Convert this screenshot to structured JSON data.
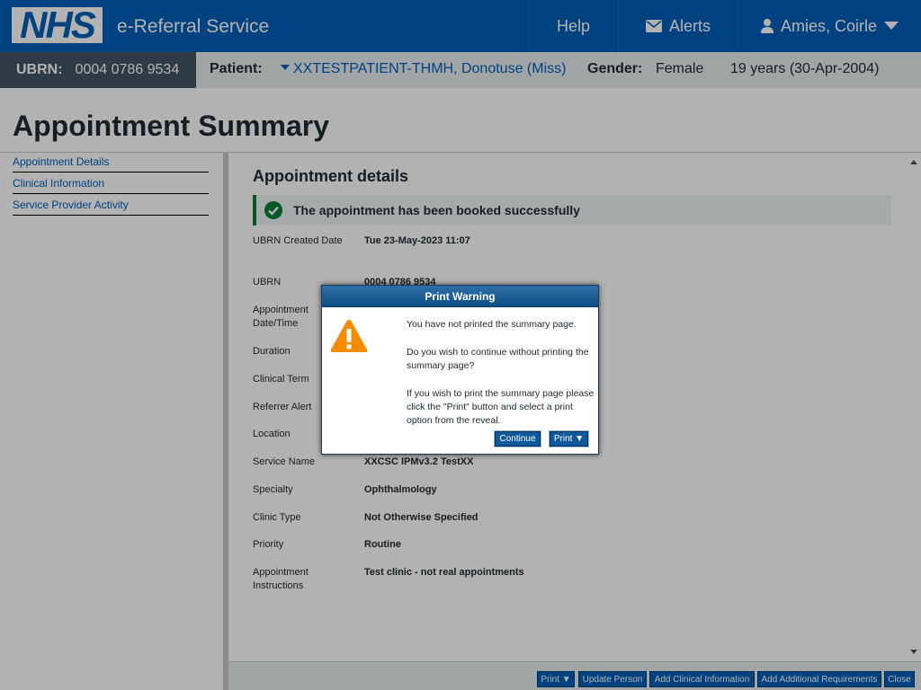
{
  "header": {
    "logo": "NHS",
    "service_name": "e-Referral Service",
    "help": "Help",
    "alerts": "Alerts",
    "user": "Amies, Coirle"
  },
  "patient_bar": {
    "ubrn_label": "UBRN:",
    "ubrn_value": "0004 0786 9534",
    "patient_label": "Patient:",
    "patient_value": "XXTESTPATIENT-THMH, Donotuse (Miss)",
    "gender_label": "Gender:",
    "gender_value": "Female",
    "age": "19 years (30-Apr-2004)"
  },
  "page_title": "Appointment Summary",
  "left_nav": [
    "Appointment Details",
    "Clinical Information",
    "Service Provider Activity"
  ],
  "content": {
    "section_title": "Appointment details",
    "success_message": "The appointment has been booked successfully",
    "rows": [
      {
        "key": "UBRN Created Date",
        "value": "Tue 23-May-2023 11:07"
      },
      {
        "key": "UBRN",
        "value": "0004 0786 9534"
      },
      {
        "key": "Appointment Date/Time",
        "value": ""
      },
      {
        "key": "Duration",
        "value": ""
      },
      {
        "key": "Clinical Term",
        "value": ""
      },
      {
        "key": "Referrer Alert",
        "value": ""
      },
      {
        "key": "Location",
        "value": ""
      },
      {
        "key": "Service Name",
        "value": "XXCSC IPMv3.2 TestXX"
      },
      {
        "key": "Specialty",
        "value": "Ophthalmology"
      },
      {
        "key": "Clinic Type",
        "value": "Not Otherwise Specified"
      },
      {
        "key": "Priority",
        "value": "Routine"
      },
      {
        "key": "Appointment Instructions",
        "value": "Test clinic - not real appointments"
      }
    ]
  },
  "toolbar": {
    "print": "Print ▼",
    "update_person": "Update Person",
    "add_clinical": "Add Clinical Information",
    "add_requirements": "Add Additional Requirements",
    "close": "Close"
  },
  "dialog": {
    "title": "Print Warning",
    "line1": "You have not printed the summary page.",
    "line2": "Do you wish to continue without printing the summary page?",
    "line3": "If you wish to print the summary page please click the \"Print\" button and select a print option from the reveal.",
    "continue": "Continue",
    "print": "Print ▼"
  },
  "colors": {
    "nhs_blue": "#005eb8",
    "success_green": "#007f3b",
    "warning_orange": "#f58b00"
  }
}
